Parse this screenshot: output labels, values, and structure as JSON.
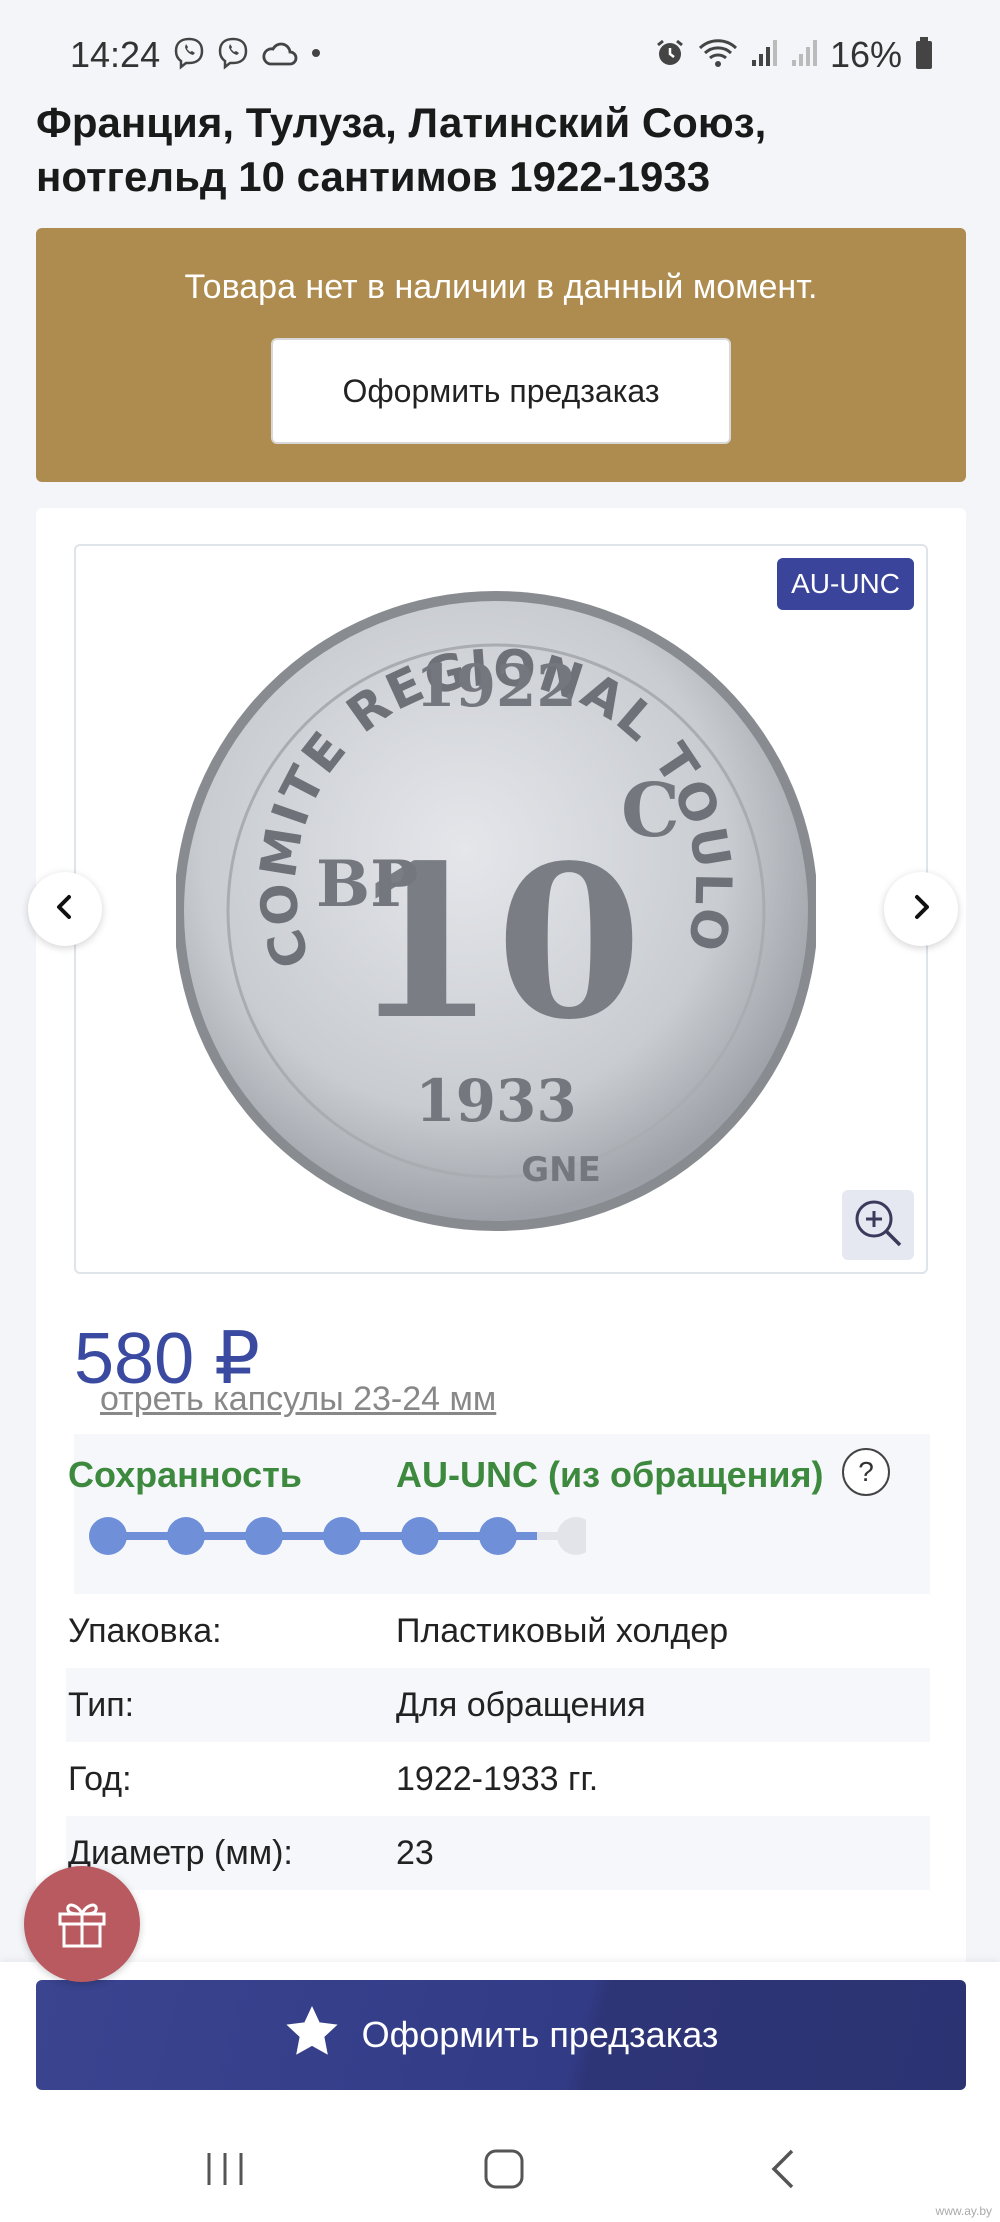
{
  "status_bar": {
    "time": "14:24",
    "battery": "16%",
    "icons_left": [
      "viber-icon",
      "viber-icon",
      "cloud-icon",
      "dot-icon"
    ],
    "icons_right": [
      "alarm-icon",
      "wifi-icon",
      "signal-icon",
      "signal-icon",
      "battery-icon"
    ]
  },
  "product": {
    "title": "Франция, Тулуза, Латинский Союз, нотгельд 10 сантимов 1922-1933",
    "price": "580 ₽",
    "grade_badge": "AU-UNC"
  },
  "stock_banner": {
    "message": "Товара нет в наличии в данный момент.",
    "button_label": "Оформить предзаказ",
    "color": "#ae8b4e"
  },
  "coin": {
    "legend_top": "COMITE REGIONAL TOULOUSE DEPT",
    "legend_suffix": "GNE",
    "year_top": "1922",
    "year_bottom": "1933",
    "denomination": "10",
    "left_mark": "BP",
    "right_mark": "C"
  },
  "condition": {
    "label": "Сохранность",
    "value": "AU-UNC (из обращения)",
    "help": "?",
    "level": 6,
    "max_level": 7,
    "color": "#3d8a3f"
  },
  "specs": [
    {
      "key": "Упаковка:",
      "value": "Пластиковый холдер"
    },
    {
      "key": "Тип:",
      "value": "Для обращения"
    },
    {
      "key": "Год:",
      "value": "1922-1933 гг."
    },
    {
      "key": "Диаметр (мм):",
      "value": "23"
    }
  ],
  "capsule_link": "отреть капсулы 23-24 мм",
  "bottom_button": {
    "label": "Оформить предзаказ",
    "icon": "star-icon"
  },
  "watermark": "www.ay.by",
  "colors": {
    "accent": "#3a449a",
    "price": "#3a4aa0"
  }
}
